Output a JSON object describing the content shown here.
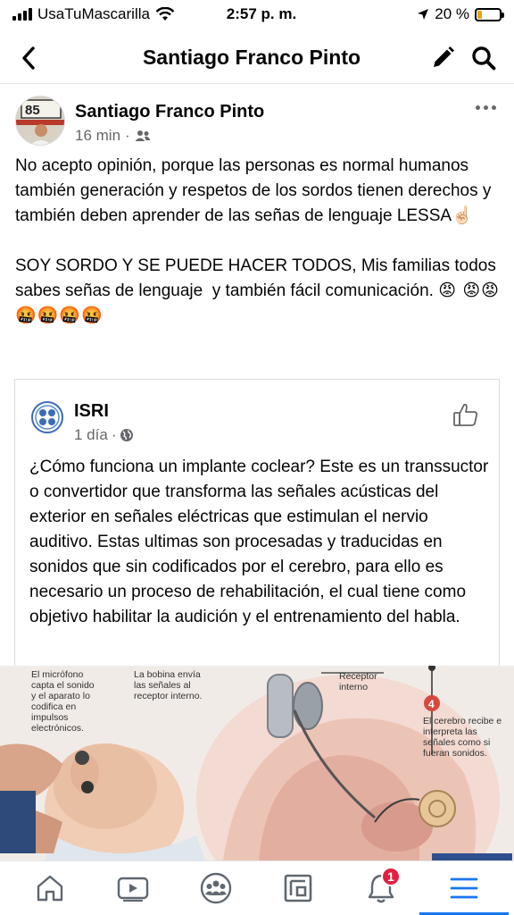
{
  "status_bar": {
    "carrier": "UsaTuMascarilla",
    "time": "2:57 p. m.",
    "battery": "20 %",
    "battery_level": 0.2,
    "battery_color": "#e8a21c"
  },
  "header": {
    "title": "Santiago Franco Pinto",
    "back_icon": "chevron-left-icon",
    "edit_icon": "pencil-icon",
    "search_icon": "search-icon"
  },
  "post": {
    "author": "Santiago Franco Pinto",
    "time": "16 min",
    "audience_icon": "friends-icon",
    "paragraph1": "No acepto opinión, porque las personas es normal humanos también generación y respetos de los sordos tienen derechos y también deben aprender de las señas de lenguaje LESSA☝🏻",
    "paragraph2": "SOY SORDO Y SE PUEDE HACER TODOS, Mis familias todos sabes señas de lenguaje  y también fácil comunicación. ",
    "emojis": "😡 😡😡🤬🤬🤬🤬"
  },
  "shared": {
    "page_name": "ISRI",
    "time": "1 día",
    "audience_icon": "globe-icon",
    "text": "¿Cómo funciona un implante coclear? Este es un transsuctor o convertidor que transforma las señales acústicas del exterior en señales eléctricas que estimulan el nervio auditivo. Estas ultimas son procesadas y traducidas en sonidos que sin codificados por el cerebro, para ello es necesario un proceso de rehabilitación, el cual tiene como objetivo habilitar  la audición y el entrenamiento del habla."
  },
  "image": {
    "caption1": "El micrófono capta el sonido y el aparato lo codifica en impulsos electrónicos.",
    "caption2": "La bobina envía las señales al receptor interno.",
    "caption3": "Receptor interno",
    "step_number": "4",
    "caption4": "El cerebro recibe e interpreta las señales como si fueran sonidos."
  },
  "bottom_nav": {
    "items": [
      "home-icon",
      "watch-icon",
      "groups-icon",
      "pages-icon",
      "notifications-icon",
      "menu-icon"
    ],
    "notifications_count": "1",
    "accent": "#1877f2"
  }
}
